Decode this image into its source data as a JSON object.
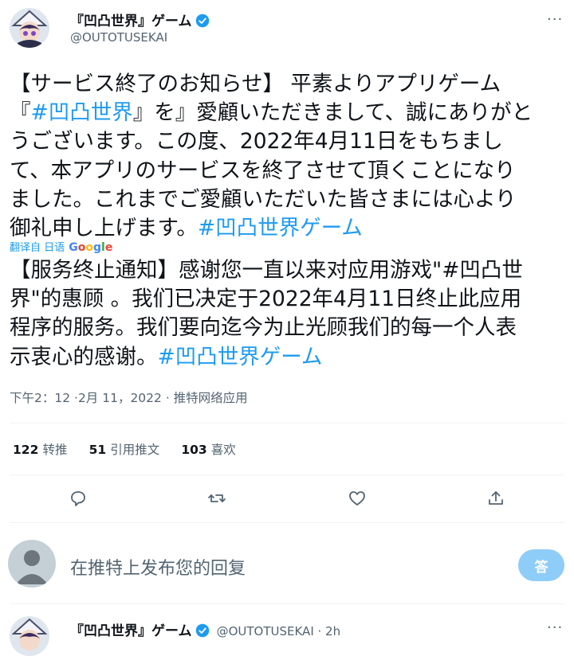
{
  "header": {
    "display_name": "『凹凸世界』ゲーム",
    "handle": "@OUTOTUSEKAI",
    "more": "···"
  },
  "tweet": {
    "lines": [
      "【サービス終了のお知らせ】 平素よりアプリゲーム",
      "『",
      "』を』愛顧いただきまして、誠にありがと",
      "うございます。この度、2022年4月11日をもちまし",
      "て、本アプリのサービスを終了させて頂くことになり",
      "ました。これまでご愛顧いただいた皆さまには心より",
      "御礼申し上げます。"
    ],
    "hashtag_inline": "#凹凸世界",
    "hashtag_end": "#凹凸世界ゲーム"
  },
  "translation": {
    "label": "翻译自 日语",
    "provider": "Google",
    "lines": [
      "【服务终止通知】感谢您一直以来对应用游戏\"#凹凸世",
      "界\"的惠顾 。我们已决定于2022年4月11日终止此应用",
      "程序的服务。我们要向迄今为止光顾我们的每一个人表",
      "示衷心的感谢。"
    ],
    "hashtag": "#凹凸世界ゲーム"
  },
  "meta": "下午2：12 ·2月 11，2022 · 推特网络应用",
  "stats": {
    "retweets_count": "122",
    "retweets_label": "转推",
    "quotes_count": "51",
    "quotes_label": "引用推文",
    "likes_count": "103",
    "likes_label": "喜欢"
  },
  "actions": {
    "reply_icon": "reply-icon",
    "retweet_icon": "retweet-icon",
    "like_icon": "heart-icon",
    "share_icon": "share-icon"
  },
  "reply": {
    "placeholder": "在推特上发布您的回复",
    "button": "答"
  },
  "next_tweet": {
    "display_name": "『凹凸世界』ゲーム",
    "handle_time": "@OUTOTUSEKAI · 2h",
    "more": "···"
  },
  "colors": {
    "accent": "#1d9bf0",
    "secondary_text": "#536471",
    "divider": "#eff3f4",
    "reply_button": "#8ecdf8"
  }
}
